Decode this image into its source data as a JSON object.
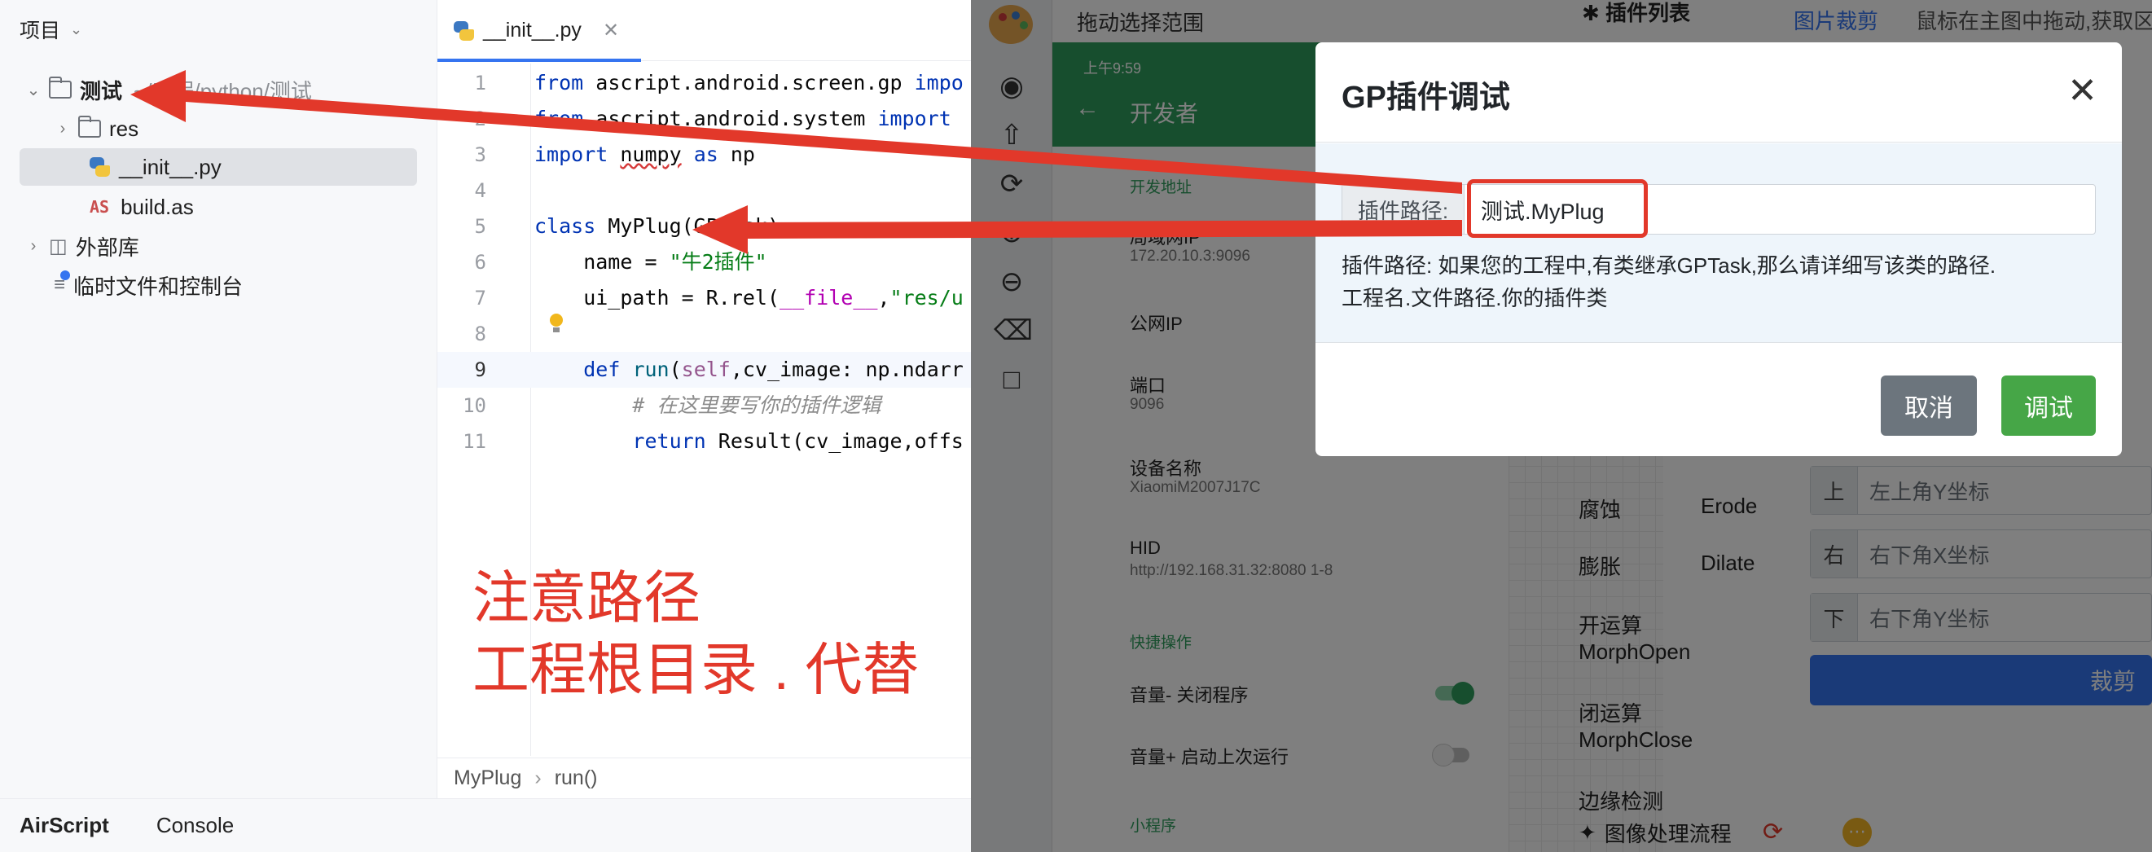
{
  "project": {
    "header": "项目",
    "tree": [
      {
        "label": "测试",
        "hint": "~/工程/python/测试"
      },
      {
        "label": "res"
      },
      {
        "label": "__init__.py"
      },
      {
        "label": "build.as"
      },
      {
        "label": "外部库"
      },
      {
        "label": "临时文件和控制台"
      }
    ]
  },
  "editor": {
    "tab": "__init__.py",
    "breadcrumb": [
      "MyPlug",
      "run()"
    ],
    "line_numbers": [
      "1",
      "2",
      "3",
      "4",
      "5",
      "6",
      "7",
      "8",
      "9",
      "10",
      "11"
    ],
    "annotation": "注意路径\n工程根目录 . 代替"
  },
  "bottom_bar": [
    "AirScript",
    "Console"
  ],
  "app": {
    "drag_title": "拖动选择范围",
    "phone": {
      "status": "上午9:59",
      "title": "开发者",
      "section_dev": "开发地址",
      "lan_label": "局域网IP",
      "lan_value": "172.20.10.3:9096",
      "public_ip": "公网IP",
      "port_label": "端口",
      "port_value": "9096",
      "device_label": "设备名称",
      "device_value": "XiaomiM2007J17C",
      "hid_label": "HID",
      "hid_value": "http://192.168.31.32:8080 1-8",
      "section_quick": "快捷操作",
      "vol_down": "音量- 关闭程序",
      "vol_up": "音量+ 启动上次运行",
      "section_mini": "小程序"
    },
    "ops": {
      "plugin_list": "插件列表",
      "crop_link": "图片裁剪",
      "drag_hint": "鼠标在主图中拖动,获取区",
      "rows": [
        {
          "zh": "腐蚀",
          "en": "Erode"
        },
        {
          "zh": "膨胀",
          "en": "Dilate"
        },
        {
          "zh": "开运算",
          "en": "MorphOpen"
        },
        {
          "zh": "闭运算",
          "en": "MorphClose"
        },
        {
          "zh": "边缘检测",
          "en": ""
        }
      ],
      "coords": [
        {
          "label": "上",
          "placeholder": "左上角Y坐标"
        },
        {
          "label": "右",
          "placeholder": "右下角X坐标"
        },
        {
          "label": "下",
          "placeholder": "右下角Y坐标"
        }
      ],
      "crop_button": "裁剪",
      "pipeline": "图像处理流程"
    },
    "modal": {
      "title": "GP插件调试",
      "input_label": "插件路径:",
      "input_value": "测试.MyPlug",
      "help": "插件路径: 如果您的工程中,有类继承GPTask,那么请详细写该类的路径.\n工程名.文件路径.你的插件类",
      "cancel": "取消",
      "debug": "调试"
    }
  },
  "colors": {
    "annotation_red": "#e2382a",
    "accent_blue": "#3574f0",
    "phone_green": "#2e9d5c",
    "debug_green": "#46a647",
    "cancel_gray": "#6c757d"
  }
}
